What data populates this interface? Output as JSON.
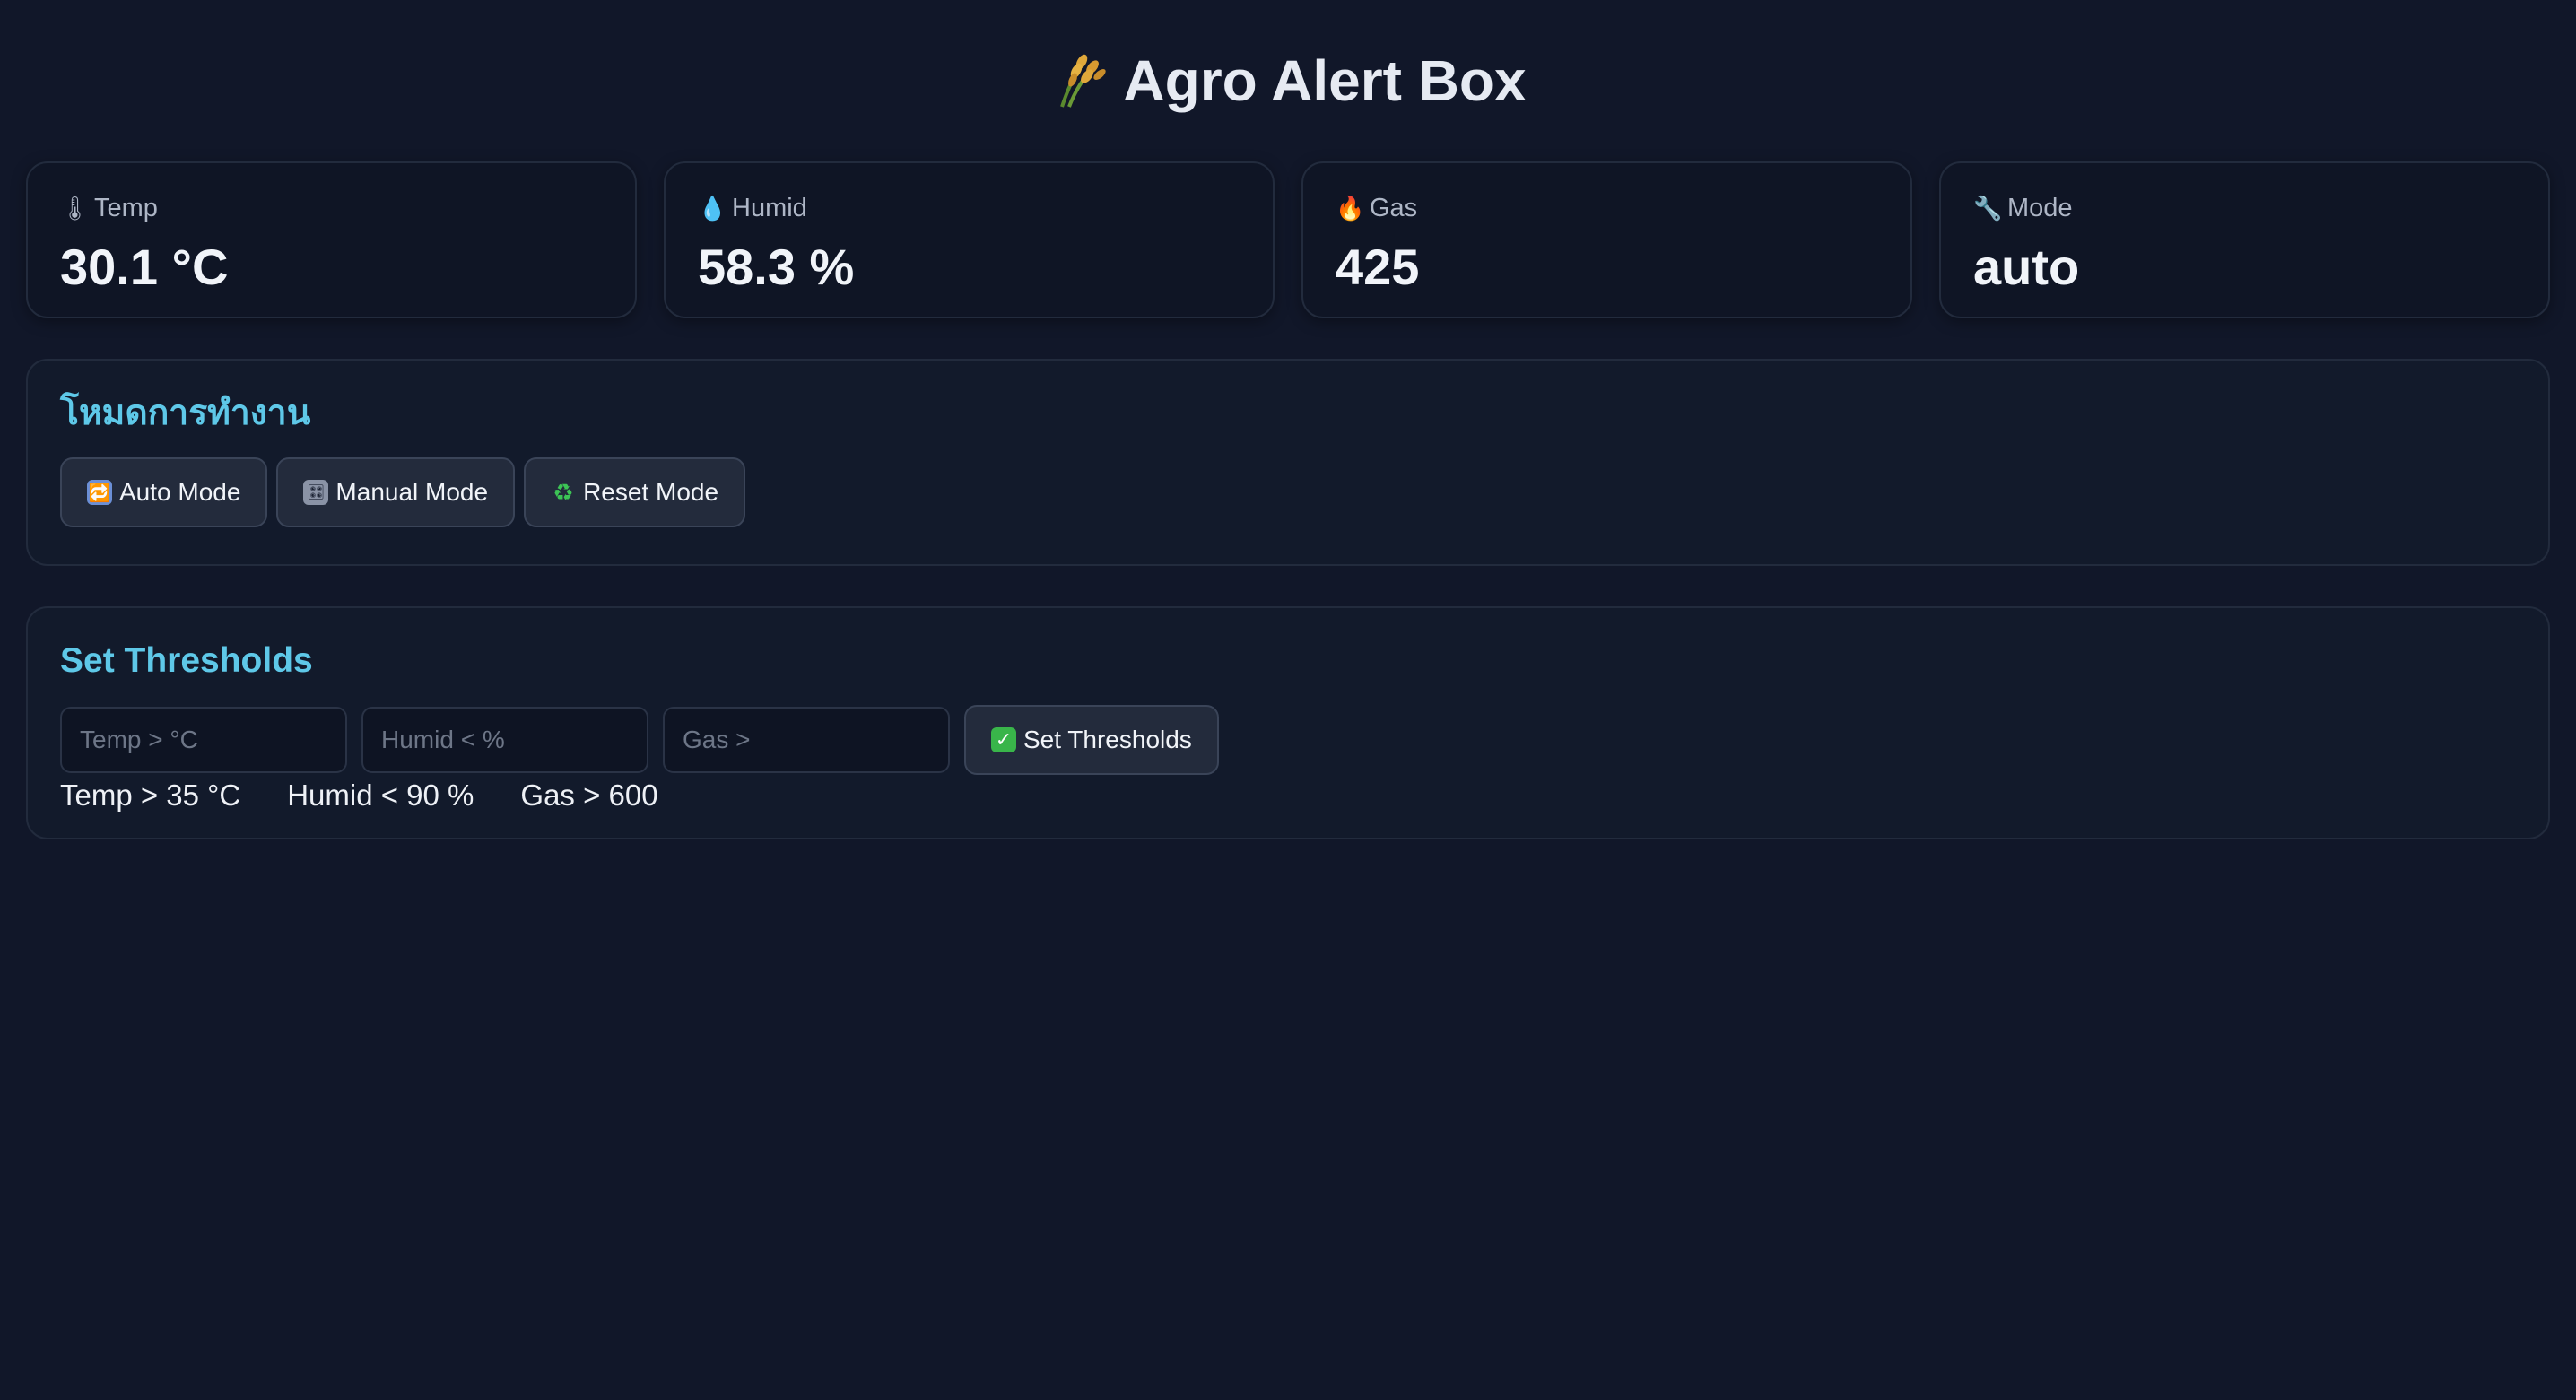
{
  "header": {
    "icon": "rice-sheaf-icon",
    "title": "Agro Alert Box"
  },
  "cards": [
    {
      "icon": "thermometer-icon",
      "glyph": "🌡",
      "label": "Temp",
      "value": "30.1 °C"
    },
    {
      "icon": "droplet-icon",
      "glyph": "💧",
      "label": "Humid",
      "value": "58.3 %"
    },
    {
      "icon": "fire-icon",
      "glyph": "🔥",
      "label": "Gas",
      "value": "425"
    },
    {
      "icon": "wrench-icon",
      "glyph": "🔧",
      "label": "Mode",
      "value": "auto"
    }
  ],
  "mode_panel": {
    "title": "โหมดการทำงาน",
    "buttons": [
      {
        "icon": "repeat-icon",
        "glyph": "🔁",
        "label": "Auto Mode"
      },
      {
        "icon": "control-knobs-icon",
        "glyph": "🎛",
        "label": "Manual Mode"
      },
      {
        "icon": "recycle-icon",
        "glyph": "♻",
        "label": "Reset Mode"
      }
    ]
  },
  "threshold_panel": {
    "title": "Set Thresholds",
    "inputs": [
      {
        "placeholder": "Temp > °C",
        "value": ""
      },
      {
        "placeholder": "Humid < %",
        "value": ""
      },
      {
        "placeholder": "Gas >",
        "value": ""
      }
    ],
    "submit": {
      "icon": "check-mark-icon",
      "glyph": "✓",
      "label": "Set Thresholds"
    },
    "current": {
      "temp": "Temp > 35 °C",
      "humid": "Humid < 90 %",
      "gas": "Gas > 600"
    }
  },
  "colors": {
    "background": "#111729",
    "accent": "#5ec8e8",
    "card_border": "#222b3d",
    "button_bg": "#232b3c"
  }
}
